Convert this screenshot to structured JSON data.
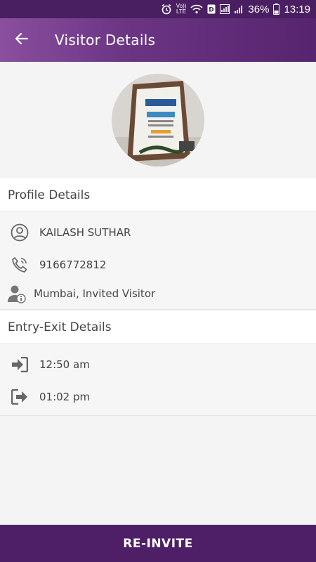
{
  "status_bar": {
    "volte_line1": "Vo))",
    "volte_line2": "LTE",
    "battery_percent": "36%",
    "time": "13:19",
    "icons": [
      "alarm-icon",
      "volte-icon",
      "wifi-icon",
      "data-icon",
      "signal-icon",
      "signal-bars-icon",
      "battery-icon"
    ]
  },
  "app_bar": {
    "title": "Visitor Details",
    "back_icon": "arrow-left-icon",
    "gradient_start": "#8a4f9f",
    "gradient_end": "#57246f"
  },
  "profile": {
    "section_title": "Profile Details",
    "name": "KAILASH SUTHAR",
    "phone": "9166772812",
    "location_type": "Mumbai, Invited Visitor",
    "icons": [
      "person-circle-icon",
      "phone-icon",
      "visitor-info-icon"
    ]
  },
  "entry_exit": {
    "section_title": "Entry-Exit Details",
    "entry_time": "12:50 am",
    "exit_time": "01:02 pm",
    "icons": [
      "sign-in-icon",
      "sign-out-icon"
    ]
  },
  "actions": {
    "reinvite_label": "RE-INVITE",
    "button_color": "#4e1f66"
  }
}
